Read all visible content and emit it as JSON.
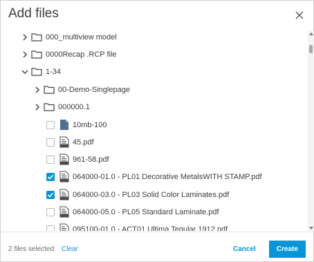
{
  "dialog": {
    "title": "Add files",
    "close_icon": "close-icon"
  },
  "tree": {
    "folders": [
      {
        "label": "000_multiview model",
        "expanded": false
      },
      {
        "label": "0000Recap .RCP file",
        "expanded": false
      },
      {
        "label": "1-34",
        "expanded": true
      }
    ],
    "subfolders": [
      {
        "label": "00-Demo-Singlepage",
        "expanded": false
      },
      {
        "label": "000000.1",
        "expanded": false
      }
    ],
    "files": [
      {
        "label": "10mb-100",
        "checked": false,
        "icon": "generic-file-icon"
      },
      {
        "label": "45.pdf",
        "checked": false,
        "icon": "pdf-file-icon"
      },
      {
        "label": "961-58.pdf",
        "checked": false,
        "icon": "pdf-file-icon"
      },
      {
        "label": "064000-01.0 - PL01 Decorative MetalsWITH STAMP.pdf",
        "checked": true,
        "icon": "pdf-file-icon"
      },
      {
        "label": "064000-03.0 - PL03 Solid Color Laminates.pdf",
        "checked": true,
        "icon": "pdf-file-icon"
      },
      {
        "label": "064000-05.0 - PL05 Standard Laminate.pdf",
        "checked": false,
        "icon": "pdf-file-icon"
      },
      {
        "label": "095100-01.0 - ACT01 Ultima Tegular 1912.pdf",
        "checked": false,
        "icon": "pdf-file-icon"
      }
    ]
  },
  "footer": {
    "selected_text": "2 files selected",
    "clear_label": "Clear",
    "cancel_label": "Cancel",
    "create_label": "Create"
  },
  "colors": {
    "accent": "#0696d7",
    "text": "#3c3c3c",
    "icon": "#4a4a4a"
  }
}
